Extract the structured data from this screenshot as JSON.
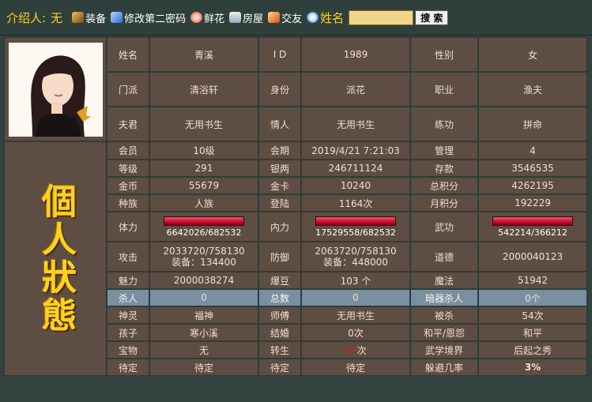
{
  "topbar": {
    "introducer_label": "介绍人:",
    "introducer_value": "无",
    "links": {
      "equip": "装备",
      "password": "修改第二密码",
      "flowers": "鲜花",
      "house": "房屋",
      "friends": "交友"
    },
    "name_label": "姓名",
    "search_value": "",
    "search_button": "搜 索"
  },
  "title": "個人狀態",
  "profile": {
    "row1": [
      "姓名",
      "青溪",
      "I D",
      "1989",
      "性别",
      "女"
    ],
    "row2": [
      "门派",
      "清浴轩",
      "身份",
      "派花",
      "职业",
      "渔夫"
    ],
    "row3": [
      "夫君",
      "无用书生",
      "情人",
      "无用书生",
      "练功",
      "拼命"
    ]
  },
  "stats": {
    "row_member": [
      "会员",
      "10级",
      "会期",
      "2019/4/21 7:21:03",
      "管理",
      "4"
    ],
    "row_level": [
      "等级",
      "291",
      "银两",
      "246711124",
      "存款",
      "3546535"
    ],
    "row_gold": [
      "金币",
      "55679",
      "金卡",
      "10240",
      "总积分",
      "4262195"
    ],
    "row_race": [
      "种族",
      "人族",
      "登陆",
      "1164次",
      "月积分",
      "192229"
    ],
    "row_power": {
      "hp_label": "体力",
      "hp_value": "6642026/682532",
      "hp_fill": 1.0,
      "mp_label": "内力",
      "mp_value": "17529558/682532",
      "mp_fill": 1.0,
      "wg_label": "武功",
      "wg_value": "542214/366212",
      "wg_fill": 1.0
    },
    "row_attack": {
      "atk_label": "攻击",
      "atk_value": "2033720/758130",
      "atk_equip": "装备：134400",
      "def_label": "防御",
      "def_value": "2063720/758130",
      "def_equip": "装备：448000",
      "moral_label": "道德",
      "moral_value": "2000040123"
    },
    "row_charm": [
      "魅力",
      "2000038274",
      "爆豆",
      "103 个",
      "魔法",
      "51942"
    ],
    "row_kill": [
      "杀人",
      "0",
      "总数",
      "0",
      "暗器杀人",
      "0个"
    ],
    "row_spirit": [
      "神灵",
      "福神",
      "师傅",
      "无用书生",
      "被杀",
      "54次"
    ],
    "row_child": [
      "孩子",
      "寒小溪",
      "结婚",
      "0次",
      "和平/恩怨",
      "和平"
    ],
    "row_treasure": {
      "l1": "宝物",
      "v1": "无",
      "l2": "转生",
      "v2_red": "11",
      "v2_suffix": "次",
      "l3": "武学境界",
      "v3": "后起之秀"
    },
    "row_pending": [
      "待定",
      "待定",
      "待定",
      "待定",
      "躲避几率",
      "3%"
    ]
  },
  "colors": {
    "gold": "#ffd700",
    "cell_bg": "#5e4d42",
    "highlight_row": "#7a8fa0",
    "page_bg": "#33423f"
  }
}
